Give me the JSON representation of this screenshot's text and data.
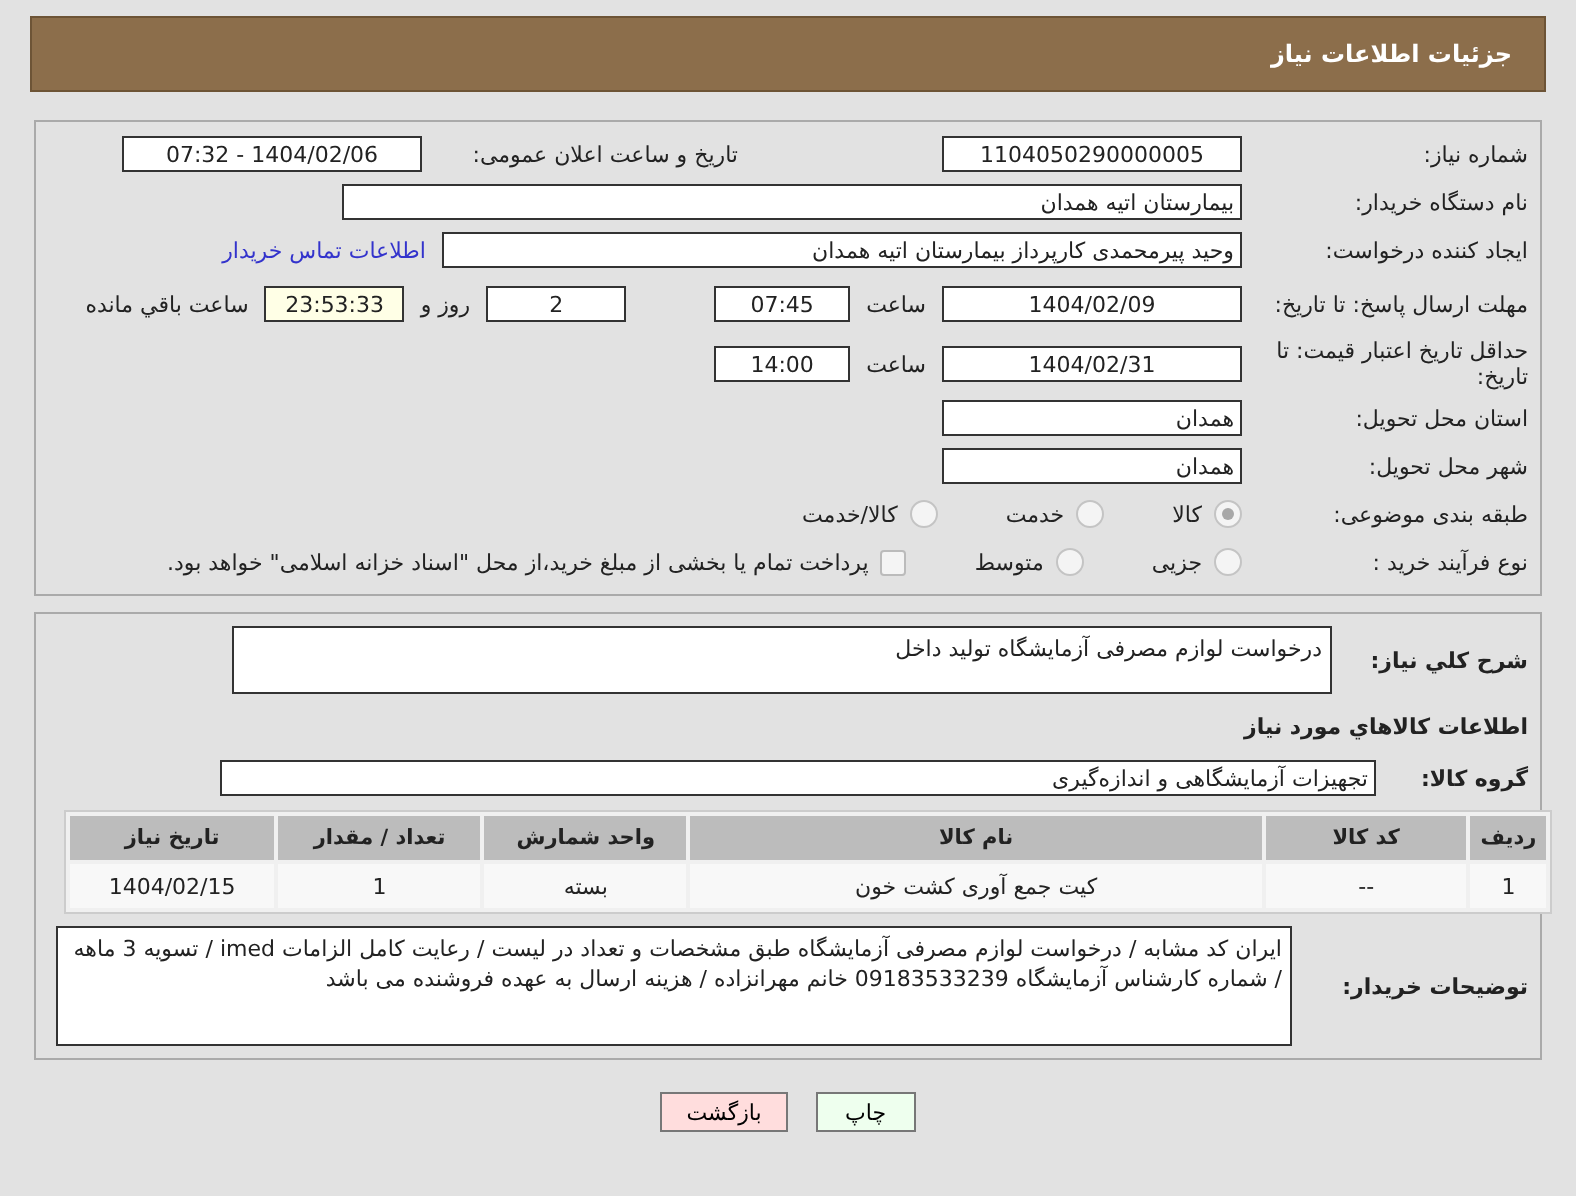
{
  "header": {
    "title": "جزئیات اطلاعات نیاز"
  },
  "need_number": {
    "label": "شماره نیاز:",
    "value": "1104050290000005"
  },
  "announce": {
    "label": "تاریخ و ساعت اعلان عمومی:",
    "value": "1404/02/06 - 07:32"
  },
  "buyer_org": {
    "label": "نام دستگاه خریدار:",
    "value": "بیمارستان اتیه همدان"
  },
  "creator": {
    "label": "ایجاد کننده درخواست:",
    "value": "وحید پیرمحمدی کارپرداز بیمارستان اتیه همدان",
    "link": "اطلاعات تماس خریدار"
  },
  "deadline": {
    "label": "مهلت ارسال پاسخ: تا تاریخ:",
    "date": "1404/02/09",
    "time_label": "ساعت",
    "time": "07:45",
    "days": "2",
    "days_label": "روز و",
    "remaining": "23:53:33",
    "remaining_label": "ساعت باقي مانده"
  },
  "validity": {
    "label": "حداقل تاریخ اعتبار قیمت: تا تاریخ:",
    "date": "1404/02/31",
    "time_label": "ساعت",
    "time": "14:00"
  },
  "province": {
    "label": "استان محل تحویل:",
    "value": "همدان"
  },
  "city": {
    "label": "شهر محل تحویل:",
    "value": "همدان"
  },
  "category": {
    "label": "طبقه بندی موضوعی:",
    "options": [
      {
        "label": "کالا",
        "selected": true
      },
      {
        "label": "خدمت",
        "selected": false
      },
      {
        "label": "کالا/خدمت",
        "selected": false
      }
    ]
  },
  "process": {
    "label": "نوع فرآیند خرید :",
    "options": [
      {
        "label": "جزیی",
        "selected": false
      },
      {
        "label": "متوسط",
        "selected": false
      }
    ],
    "treasury": {
      "label": "پرداخت تمام یا بخشی از مبلغ خرید،از محل \"اسناد خزانه اسلامی\" خواهد بود.",
      "checked": false
    }
  },
  "description": {
    "label": "شرح کلي نياز:",
    "value": "درخواست لوازم مصرفی آزمایشگاه تولید داخل"
  },
  "goods_heading": "اطلاعات کالاهاي مورد نياز",
  "goods_group": {
    "label": "گروه کالا:",
    "value": "تجهیزات آزمایشگاهی و اندازه‌گیری"
  },
  "table": {
    "columns": [
      "ردیف",
      "کد کالا",
      "نام کالا",
      "واحد شمارش",
      "تعداد / مقدار",
      "تاریخ نیاز"
    ],
    "rows": [
      [
        "1",
        "--",
        "کیت جمع آوری کشت خون",
        "بسته",
        "1",
        "1404/02/15"
      ]
    ]
  },
  "buyer_notes": {
    "label": "توضیحات خریدار:",
    "value": "ایران کد مشابه / درخواست لوازم مصرفی آزمایشگاه طبق مشخصات و تعداد در لیست / رعایت کامل الزامات imed / تسویه 3 ماهه / شماره کارشناس آزمایشگاه 09183533239  خانم مهرانزاده / هزینه ارسال به عهده فروشنده می باشد"
  },
  "buttons": [
    {
      "kind": "print",
      "label": "چاپ"
    },
    {
      "kind": "back",
      "label": "بازگشت"
    }
  ]
}
